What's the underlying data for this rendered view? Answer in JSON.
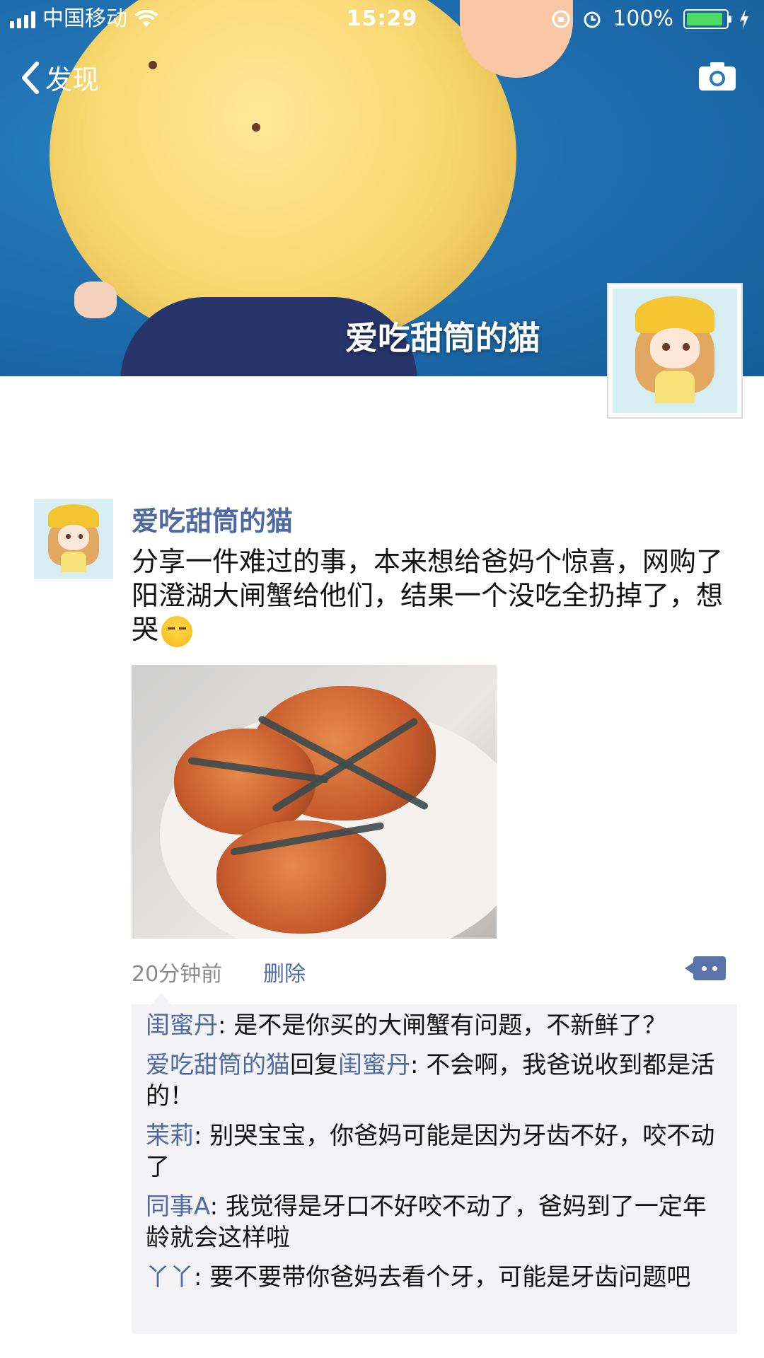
{
  "status_bar": {
    "carrier": "中国移动",
    "time": "15:29",
    "battery": "100%"
  },
  "nav": {
    "back_label": "发现",
    "camera_icon": "camera-icon"
  },
  "profile": {
    "name": "爱吃甜筒的猫"
  },
  "post": {
    "author": "爱吃甜筒的猫",
    "text": "分享一件难过的事，本来想给爸妈个惊喜，网购了阳澄湖大闸蟹给他们，结果一个没吃全扔掉了，想哭",
    "time": "20分钟前",
    "delete_label": "删除"
  },
  "comments": [
    {
      "name": "闺蜜丹",
      "text": ": 是不是你买的大闸蟹有问题，不新鲜了？"
    },
    {
      "name": "爱吃甜筒的猫",
      "reply_label": "回复",
      "reply_to": "闺蜜丹",
      "text": ": 不会啊，我爸说收到都是活的！"
    },
    {
      "name": "茉莉",
      "text": ": 别哭宝宝，你爸妈可能是因为牙齿不好，咬不动了"
    },
    {
      "name": "同事A",
      "text": ": 我觉得是牙口不好咬不动了，爸妈到了一定年龄就会这样啦"
    },
    {
      "name": "丫丫",
      "text": ": 要不要带你爸妈去看个牙，可能是牙齿问题吧"
    }
  ],
  "colors": {
    "link_blue": "#4f6aa3",
    "battery_green": "#4cd964",
    "comment_bg": "#f3f3f5"
  }
}
